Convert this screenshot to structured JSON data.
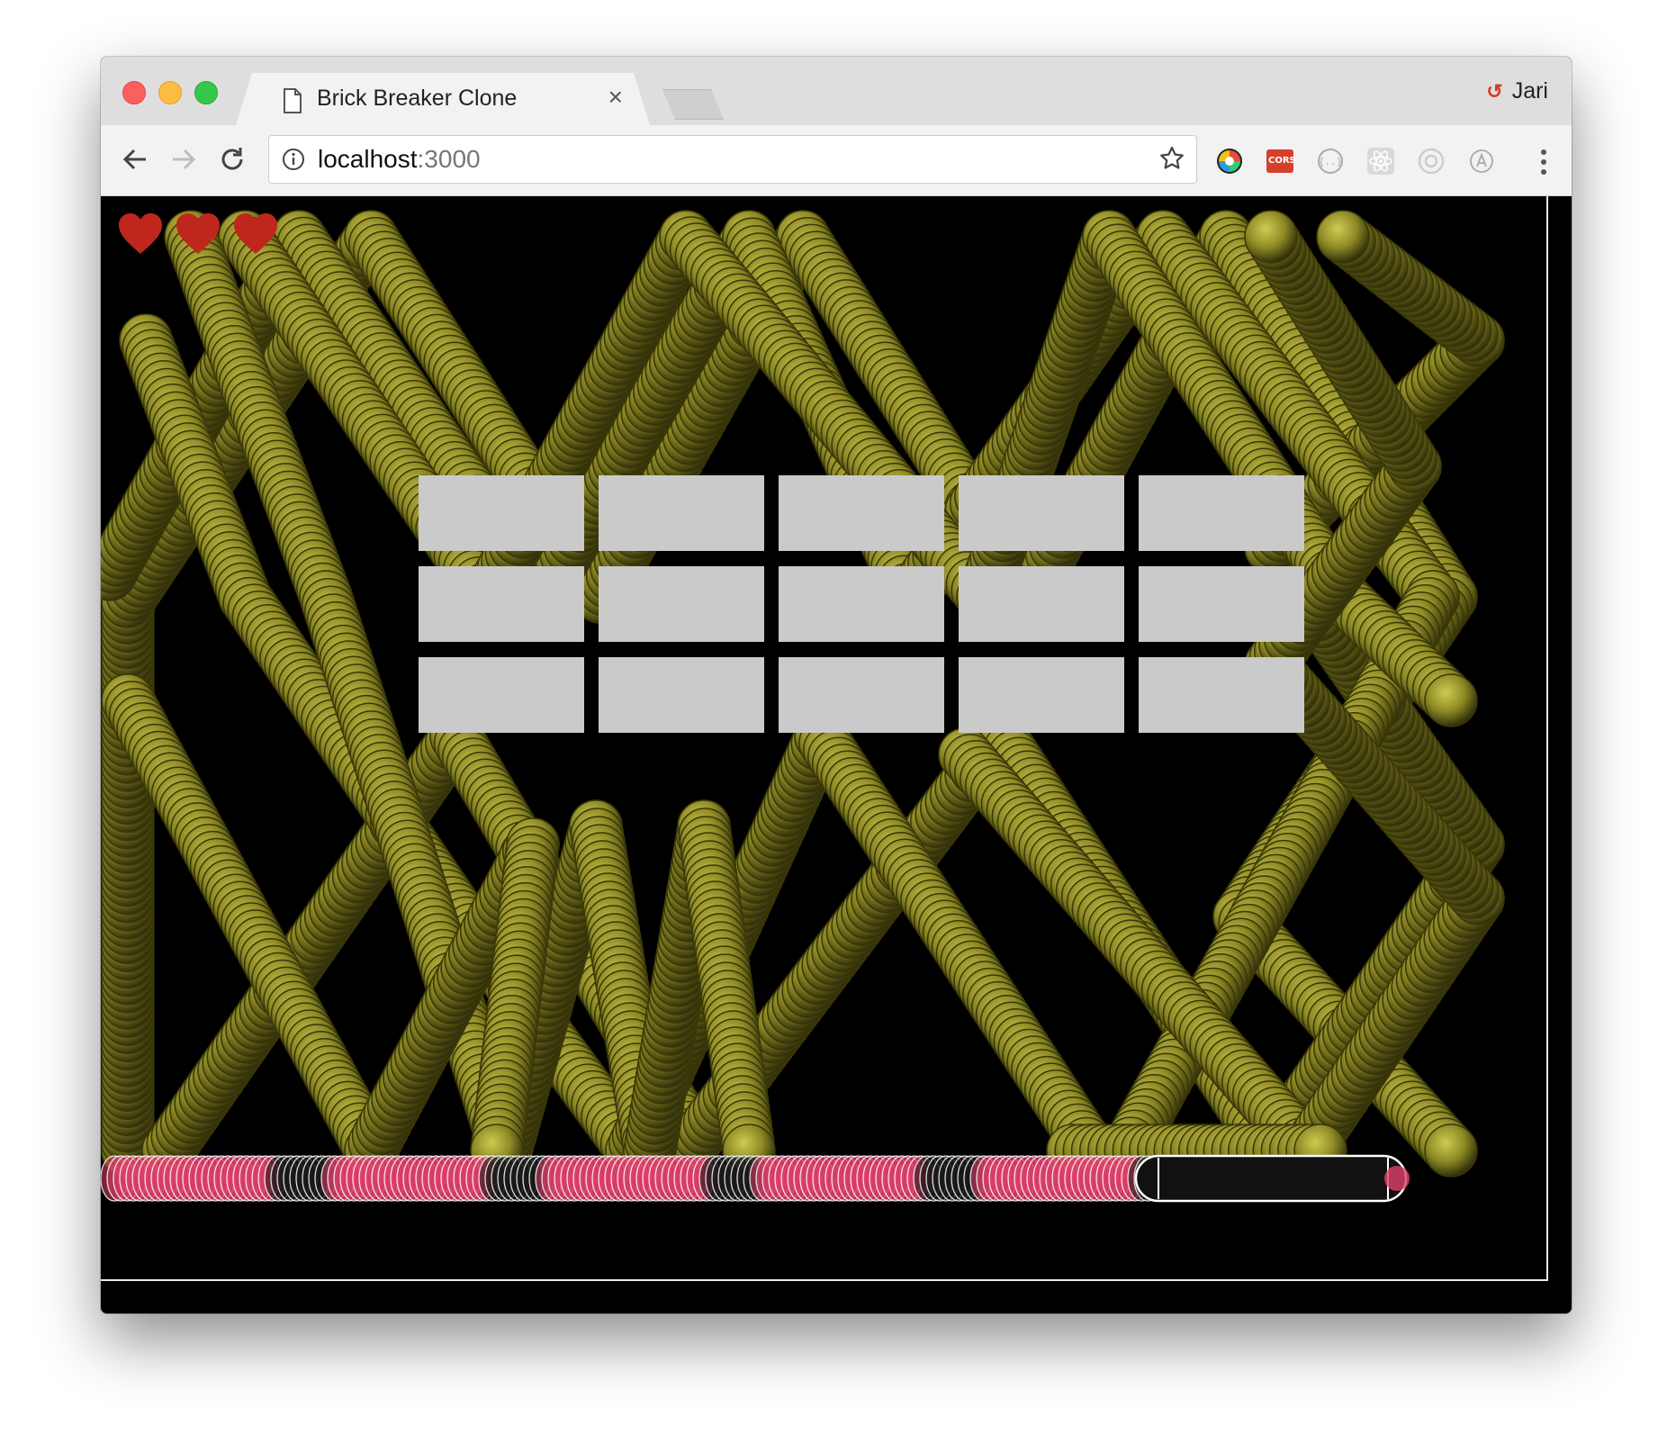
{
  "browser": {
    "tab_title": "Brick Breaker Clone",
    "tab_close": "×",
    "profile_name": "Jari",
    "profile_icon_text": "↺",
    "url_host": "localhost",
    "url_port": ":3000",
    "extensions": [
      "color-wheel-icon",
      "cors-icon",
      "json-viewer-icon",
      "react-devtools-icon",
      "redux-devtools-icon",
      "adblock-icon"
    ],
    "cors_label": "CORS"
  },
  "game": {
    "lives": 3,
    "colors": {
      "ball": "#8e8a25",
      "ball_highlight": "#c9c54a",
      "ball_shadow": "#3a3808",
      "brick": "#cacaca",
      "heart": "#c0271c",
      "paddle_trail": "#e0406a"
    },
    "bricks": {
      "rows": 3,
      "columns": 5
    }
  }
}
